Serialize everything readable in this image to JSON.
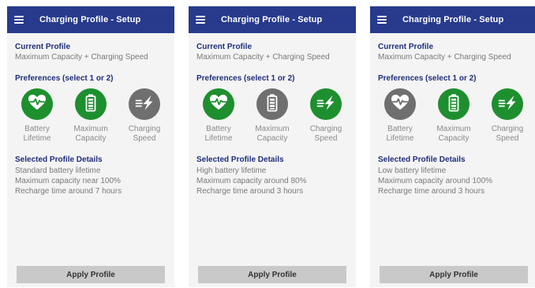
{
  "colors": {
    "appbar": "#273a8c",
    "selected": "#1e8f2e",
    "unselected": "#6f6f6f",
    "title_text": "#1f2f7a",
    "button": "#c9c9c9"
  },
  "screens": [
    {
      "appbar_title": "Charging Profile - Setup",
      "current_profile_title": "Current Profile",
      "current_profile_value": "Maximum Capacity + Charging Speed",
      "preferences_title": "Preferences (select 1 or 2)",
      "options": [
        {
          "icon": "heart-pulse-icon",
          "line1": "Battery",
          "line2": "Lifetime",
          "selected": true
        },
        {
          "icon": "battery-icon",
          "line1": "Maximum",
          "line2": "Capacity",
          "selected": true
        },
        {
          "icon": "fast-charge-icon",
          "line1": "Charging",
          "line2": "Speed",
          "selected": false
        }
      ],
      "details_title": "Selected Profile Details",
      "details": [
        "Standard battery lifetime",
        "Maximum capacity near 100%",
        "Recharge time around 7 hours"
      ],
      "apply_label": "Apply Profile"
    },
    {
      "appbar_title": "Charging Profile - Setup",
      "current_profile_title": "Current Profile",
      "current_profile_value": "Maximum Capacity + Charging Speed",
      "preferences_title": "Preferences (select 1 or 2)",
      "options": [
        {
          "icon": "heart-pulse-icon",
          "line1": "Battery",
          "line2": "Lifetime",
          "selected": true
        },
        {
          "icon": "battery-icon",
          "line1": "Maximum",
          "line2": "Capacity",
          "selected": false
        },
        {
          "icon": "fast-charge-icon",
          "line1": "Charging",
          "line2": "Speed",
          "selected": true
        }
      ],
      "details_title": "Selected Profile Details",
      "details": [
        "High battery lifetime",
        "Maximum capacity around 80%",
        "Recharge time around 3 hours"
      ],
      "apply_label": "Apply Profile"
    },
    {
      "appbar_title": "Charging Profile - Setup",
      "current_profile_title": "Current Profile",
      "current_profile_value": "Maximum Capacity + Charging Speed",
      "preferences_title": "Preferences (select 1 or 2)",
      "options": [
        {
          "icon": "heart-pulse-icon",
          "line1": "Battery",
          "line2": "Lifetime",
          "selected": false
        },
        {
          "icon": "battery-icon",
          "line1": "Maximum",
          "line2": "Capacity",
          "selected": true
        },
        {
          "icon": "fast-charge-icon",
          "line1": "Charging",
          "line2": "Speed",
          "selected": true
        }
      ],
      "details_title": "Selected Profile Details",
      "details": [
        "Low battery lifetime",
        "Maximum capacity around 100%",
        "Recharge time around 3 hours"
      ],
      "apply_label": "Apply Profile"
    }
  ]
}
